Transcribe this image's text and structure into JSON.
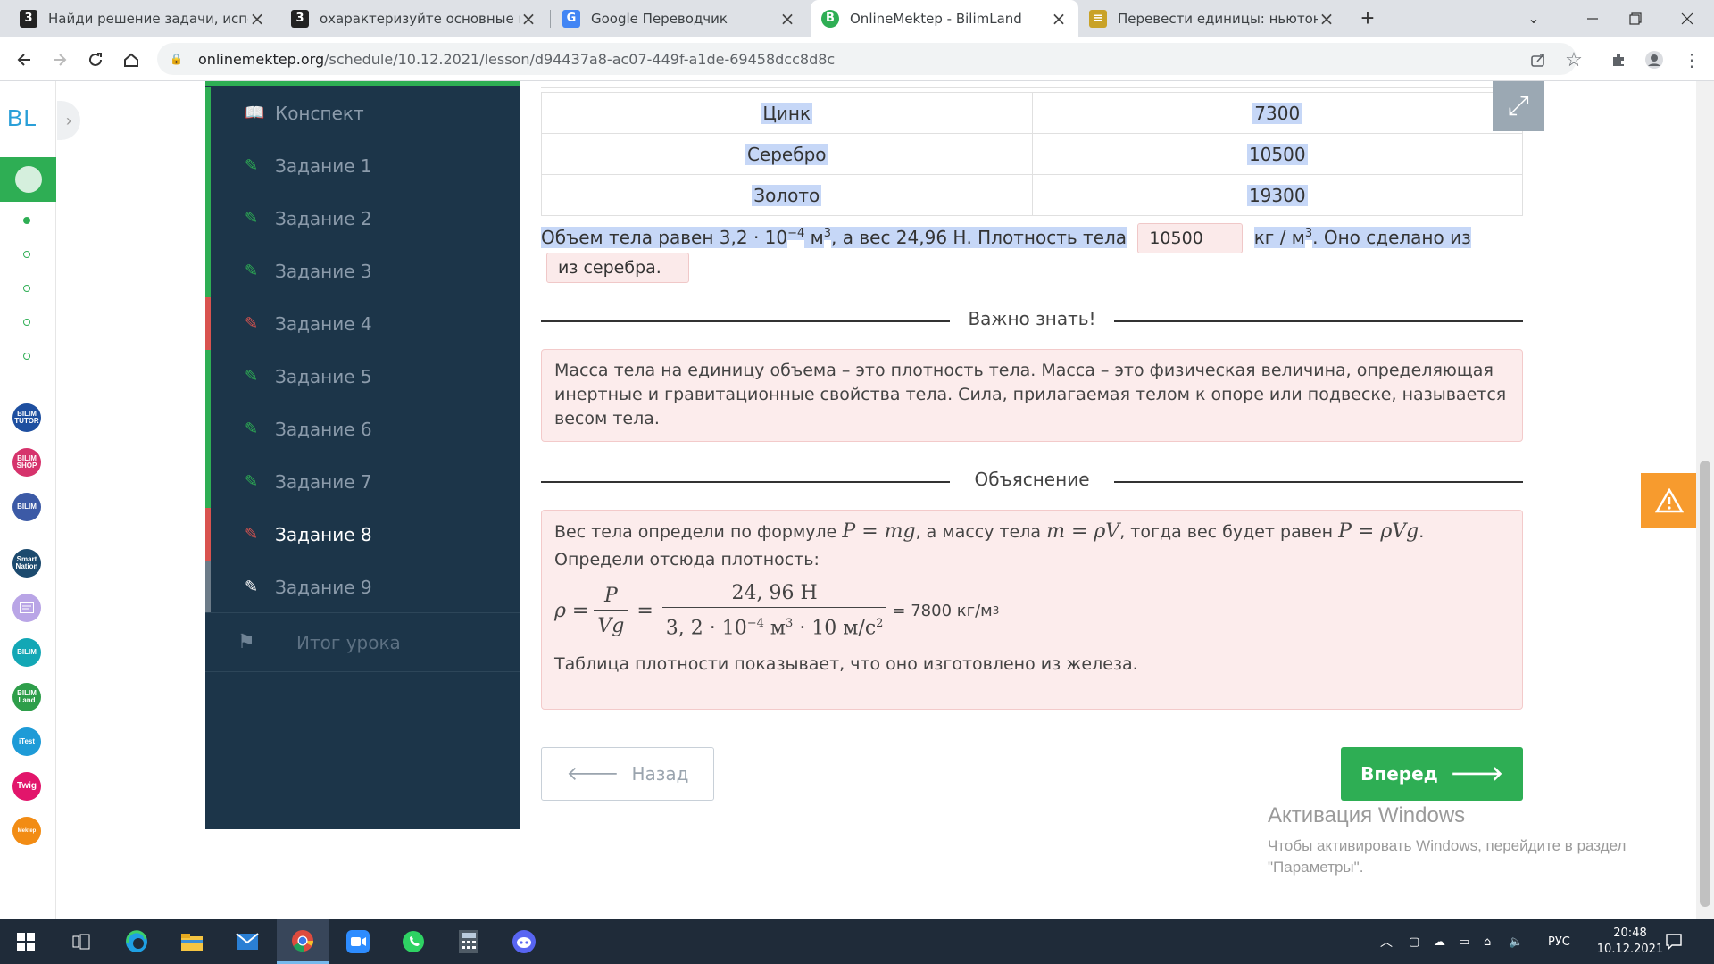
{
  "browser": {
    "tabs": [
      {
        "title": "Найди решение задачи, использ",
        "favicon": "3",
        "favicon_color": "#222222"
      },
      {
        "title": "охарактеризуйте основные при",
        "favicon": "3",
        "favicon_color": "#222222"
      },
      {
        "title": "Google Переводчик",
        "favicon": "G",
        "favicon_color": "#4285f4"
      },
      {
        "title": "OnlineMektep - BilimLand",
        "favicon": "B",
        "favicon_color": "#2eae54"
      },
      {
        "title": "Перевести единицы: ньютон [Н",
        "favicon": "≡",
        "favicon_color": "#c9a227"
      }
    ],
    "active_tab": 3,
    "url_host": "onlinemektep.org",
    "url_path": "/schedule/10.12.2021/lesson/d94437a8-ac07-449f-a1de-69458dcc8d8c"
  },
  "rail": {
    "logo": "BL",
    "apps": [
      {
        "icon": "bilim-tutor-icon",
        "label": "BILIM TUTOR",
        "color": "#1e4fa0"
      },
      {
        "icon": "bilim-shop-icon",
        "label": "BILIM SHOP",
        "color": "#d6336c"
      },
      {
        "icon": "bilim-academy-icon",
        "label": "BILIM",
        "color": "#3c5aa6"
      },
      {
        "icon": "smart-nation-icon",
        "label": "Smart Nation",
        "color": "#1c4a6e"
      },
      {
        "icon": "card-icon",
        "label": "",
        "color": "#b9a5e6"
      },
      {
        "icon": "bilim-media-icon",
        "label": "BILIM",
        "color": "#13a7b5"
      },
      {
        "icon": "bilimland-icon",
        "label": "BILIM Land",
        "color": "#2e9e4a"
      },
      {
        "icon": "itest-icon",
        "label": "iTest",
        "color": "#1e9bd7"
      },
      {
        "icon": "twig-icon",
        "label": "Twig",
        "color": "#e2156b"
      },
      {
        "icon": "mektep-icon",
        "label": "Mektep",
        "color": "#f28c14"
      }
    ]
  },
  "lesson_nav": {
    "items": [
      {
        "label": "Конспект",
        "icon": "book-icon",
        "status": "done"
      },
      {
        "label": "Задание 1",
        "icon": "edit-icon",
        "status": "done"
      },
      {
        "label": "Задание 2",
        "icon": "edit-icon",
        "status": "done"
      },
      {
        "label": "Задание 3",
        "icon": "edit-icon",
        "status": "done"
      },
      {
        "label": "Задание 4",
        "icon": "edit-icon",
        "status": "error"
      },
      {
        "label": "Задание 5",
        "icon": "edit-icon",
        "status": "done"
      },
      {
        "label": "Задание 6",
        "icon": "edit-icon",
        "status": "done"
      },
      {
        "label": "Задание 7",
        "icon": "edit-icon",
        "status": "done"
      },
      {
        "label": "Задание 8",
        "icon": "edit-icon",
        "status": "error"
      },
      {
        "label": "Задание 9",
        "icon": "edit-icon",
        "status": "none"
      }
    ],
    "current": 8,
    "final": "Итог урока",
    "colors": {
      "done": "#2eae54",
      "error": "#d9534f",
      "none": "#6c7b88"
    }
  },
  "task": {
    "table": [
      {
        "metal": "Цинк",
        "density": "7300"
      },
      {
        "metal": "Серебро",
        "density": "10500"
      },
      {
        "metal": "Золото",
        "density": "19300"
      }
    ],
    "sentence_prefix": "Объем тела равен 3,2 · 10",
    "sentence_exp": "−4",
    "sentence_unit": " м",
    "sentence_unit_exp": "3",
    "sentence_mid": ", а вес 24,96 Н. Плотность тела",
    "answer_density": "10500",
    "answer_unit": "кг / м",
    "answer_unit_exp": "3",
    "sentence_tail": ". Оно сделано из",
    "answer_material": "из серебра."
  },
  "important": {
    "heading": "Важно знать!",
    "text": "Масса тела на единицу объема – это плотность тела. Масса – это физическая величина, определяющая инертные и гравитационные свойства тела. Сила, прилагаемая телом к опоре или подвеске, называется весом тела."
  },
  "explanation": {
    "heading": "Объяснение",
    "line1_a": "Вес тела определи по формуле ",
    "line1_f1": "P = mg",
    "line1_b": ", а массу тела ",
    "line1_f2": "m = ρV",
    "line1_c": ", тогда вес будет равен ",
    "line1_f3": "P = ρVg",
    "line1_d": ".",
    "line2": "Определи отсюда плотность:",
    "formula": {
      "lhs": "ρ =",
      "num1": "P",
      "den1": "Vg",
      "eq": "=",
      "num2": "24, 96 Н",
      "den2_a": "3, 2 · 10",
      "den2_exp": "−4",
      "den2_b": " м",
      "den2_b_exp": "3",
      "den2_c": " · 10 м/с",
      "den2_c_exp": "2",
      "result": "= 7800 кг/м",
      "result_exp": "3"
    },
    "conclusion": "Таблица плотности показывает, что оно изготовлено из железа."
  },
  "buttons": {
    "back": "Назад",
    "next": "Вперед"
  },
  "windows": {
    "activation_title": "Активация Windows",
    "activation_text": "Чтобы активировать Windows, перейдите в раздел \"Параметры\".",
    "lang": "РУС",
    "time": "20:48",
    "date": "10.12.2021"
  }
}
